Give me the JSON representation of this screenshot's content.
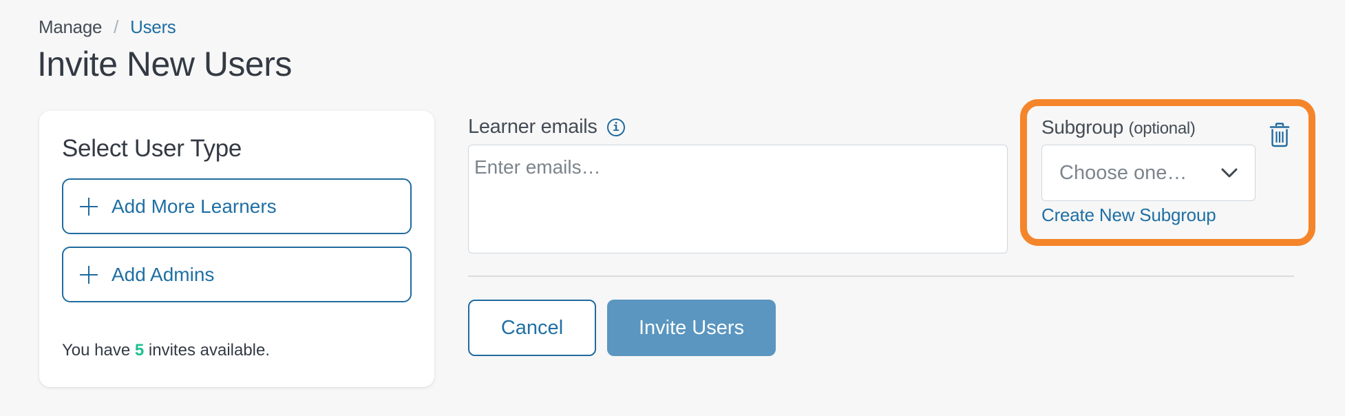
{
  "breadcrumb": {
    "items": [
      {
        "label": "Manage",
        "link": false
      },
      {
        "label": "Users",
        "link": true
      }
    ],
    "separator": "/"
  },
  "page_title": "Invite New Users",
  "user_type_card": {
    "title": "Select User Type",
    "buttons": [
      {
        "label": "Add More Learners",
        "icon": "plus-icon"
      },
      {
        "label": "Add Admins",
        "icon": "plus-icon"
      }
    ],
    "invites": {
      "prefix": "You have",
      "count": "5",
      "suffix": "invites available."
    }
  },
  "learner_emails": {
    "label": "Learner emails",
    "info_icon": "info-icon",
    "value": "",
    "placeholder": "Enter emails…"
  },
  "subgroup": {
    "label": "Subgroup",
    "optional_label": "(optional)",
    "select_placeholder": "Choose one…",
    "create_link": "Create New Subgroup",
    "delete_icon": "trash-icon",
    "highlight_color": "#f5852a"
  },
  "actions": {
    "cancel_label": "Cancel",
    "invite_label": "Invite Users"
  },
  "colors": {
    "accent": "#1f6fa3",
    "primary_button": "#5a96bf",
    "invite_count": "#1fbf8f",
    "background": "#f7f7f7"
  }
}
